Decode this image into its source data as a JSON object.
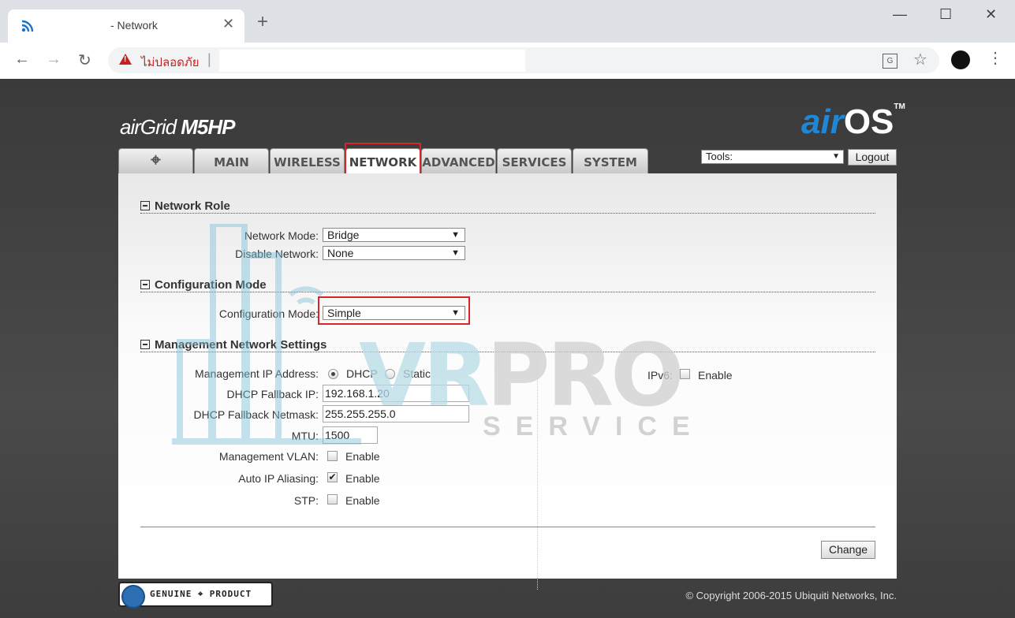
{
  "browser": {
    "tab_title": "- Network",
    "tab_close": "✕",
    "new_tab": "+",
    "window_minimize": "—",
    "window_maximize": "☐",
    "window_close": "✕",
    "back": "←",
    "forward": "→",
    "reload": "↻",
    "insecure_label": "ไม่ปลอดภัย",
    "url_separator": "|",
    "star": "☆",
    "menu": "⋮",
    "translate_glyph": "G"
  },
  "header": {
    "brand_prefix": "air",
    "brand_mid": "Grid ",
    "brand_model": "M5HP",
    "airos_air": "air",
    "airos_os": "OS",
    "airos_tm": "TM"
  },
  "nav": {
    "tabs": [
      {
        "label": "⌖",
        "icon": "ubiquiti-logo-icon"
      },
      {
        "label": "MAIN"
      },
      {
        "label": "WIRELESS"
      },
      {
        "label": "NETWORK"
      },
      {
        "label": "ADVANCED"
      },
      {
        "label": "SERVICES"
      },
      {
        "label": "SYSTEM"
      }
    ],
    "active": "NETWORK",
    "tools_value": "Tools:",
    "logout_label": "Logout"
  },
  "network_role": {
    "title": "Network Role",
    "network_mode_label": "Network Mode:",
    "network_mode_value": "Bridge",
    "disable_network_label": "Disable Network:",
    "disable_network_value": "None"
  },
  "configuration_mode": {
    "title": "Configuration Mode",
    "label": "Configuration Mode:",
    "value": "Simple"
  },
  "management": {
    "title": "Management Network Settings",
    "ip_address_label": "Management IP Address:",
    "dhcp_label": "DHCP",
    "static_label": "Static",
    "selected": "DHCP",
    "fallback_ip_label": "DHCP Fallback IP:",
    "fallback_ip_value": "192.168.1.20",
    "fallback_netmask_label": "DHCP Fallback Netmask:",
    "fallback_netmask_value": "255.255.255.0",
    "mtu_label": "MTU:",
    "mtu_value": "1500",
    "vlan_label": "Management VLAN:",
    "vlan_enable": "Enable",
    "vlan_checked": false,
    "auto_ip_label": "Auto IP Aliasing:",
    "auto_ip_enable": "Enable",
    "auto_ip_checked": true,
    "stp_label": "STP:",
    "stp_enable": "Enable",
    "stp_checked": false,
    "ipv6_label": "IPv6:",
    "ipv6_enable": "Enable",
    "ipv6_checked": false
  },
  "actions": {
    "change_label": "Change"
  },
  "footer": {
    "genuine_label": "GENUINE ⌖ PRODUCT",
    "copyright": "© Copyright 2006-2015 Ubiquiti Networks, Inc."
  },
  "watermark": {
    "vr": "VR",
    "pro": "PRO",
    "service": "SERVICE"
  },
  "colors": {
    "highlight": "#d9252a",
    "airos_blue": "#1e88d6",
    "insecure_red": "#c5221f"
  }
}
